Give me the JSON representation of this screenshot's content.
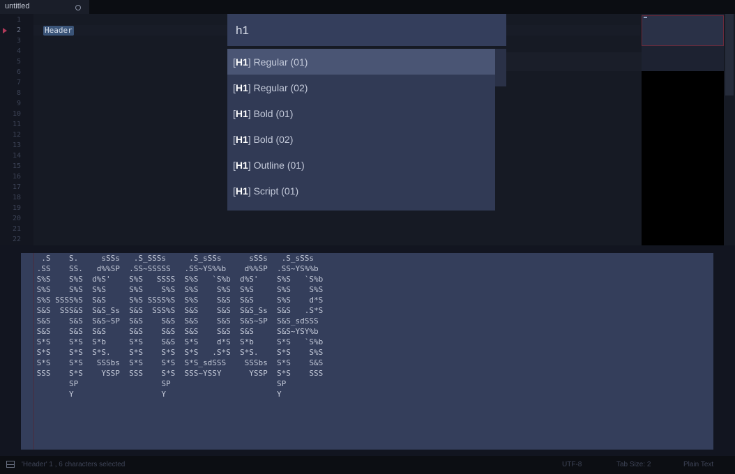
{
  "tab": {
    "title": "untitled"
  },
  "editor": {
    "line_numbers": [
      "1",
      "2",
      "3",
      "4",
      "5",
      "6",
      "7",
      "8",
      "9",
      "10",
      "11",
      "12",
      "13",
      "14",
      "15",
      "16",
      "17",
      "18",
      "19",
      "20",
      "21",
      "22"
    ],
    "selected_text": "Header"
  },
  "palette": {
    "query": "h1",
    "items": [
      {
        "tag": "H1",
        "label": "Regular (01)",
        "selected": true
      },
      {
        "tag": "H1",
        "label": "Regular (02)"
      },
      {
        "tag": "H1",
        "label": "Bold (01)"
      },
      {
        "tag": "H1",
        "label": "Bold (02)"
      },
      {
        "tag": "H1",
        "label": "Outline (01)"
      },
      {
        "tag": "H1",
        "label": "Script (01)"
      }
    ]
  },
  "output": {
    "ascii_lines": [
      "  .S    S.     sSSs   .S_SSSs     .S_sSSs      sSSs   .S_sSSs",
      " .SS    SS.   d%%SP  .SS~SSSSS   .SS~YS%%b    d%%SP  .SS~YS%%b",
      " S%S    S%S  d%S'    S%S   SSSS  S%S   `S%b  d%S'    S%S   `S%b",
      " S%S    S%S  S%S     S%S    S%S  S%S    S%S  S%S     S%S    S%S",
      " S%S SSSS%S  S&S     S%S SSSS%S  S%S    S&S  S&S     S%S    d*S",
      " S&S  SSS&S  S&S_Ss  S&S  SSS%S  S&S    S&S  S&S_Ss  S&S   .S*S",
      " S&S    S&S  S&S~SP  S&S    S&S  S&S    S&S  S&S~SP  S&S_sdSSS",
      " S&S    S&S  S&S     S&S    S&S  S&S    S&S  S&S     S&S~YSY%b",
      " S*S    S*S  S*b     S*S    S&S  S*S    d*S  S*b     S*S   `S%b",
      " S*S    S*S  S*S.    S*S    S*S  S*S   .S*S  S*S.    S*S    S%S",
      " S*S    S*S   SSSbs  S*S    S*S  S*S_sdSSS    SSSbs  S*S    S&S",
      " SSS    S*S    YSSP  SSS    S*S  SSS~YSSY      YSSP  S*S    SSS",
      "        SP                  SP                       SP",
      "        Y                   Y                        Y"
    ]
  },
  "status": {
    "selection": "'Header' 1 , 6 characters selected",
    "encoding": "UTF-8",
    "tab_size": "Tab Size: 2",
    "syntax": "Plain Text"
  }
}
